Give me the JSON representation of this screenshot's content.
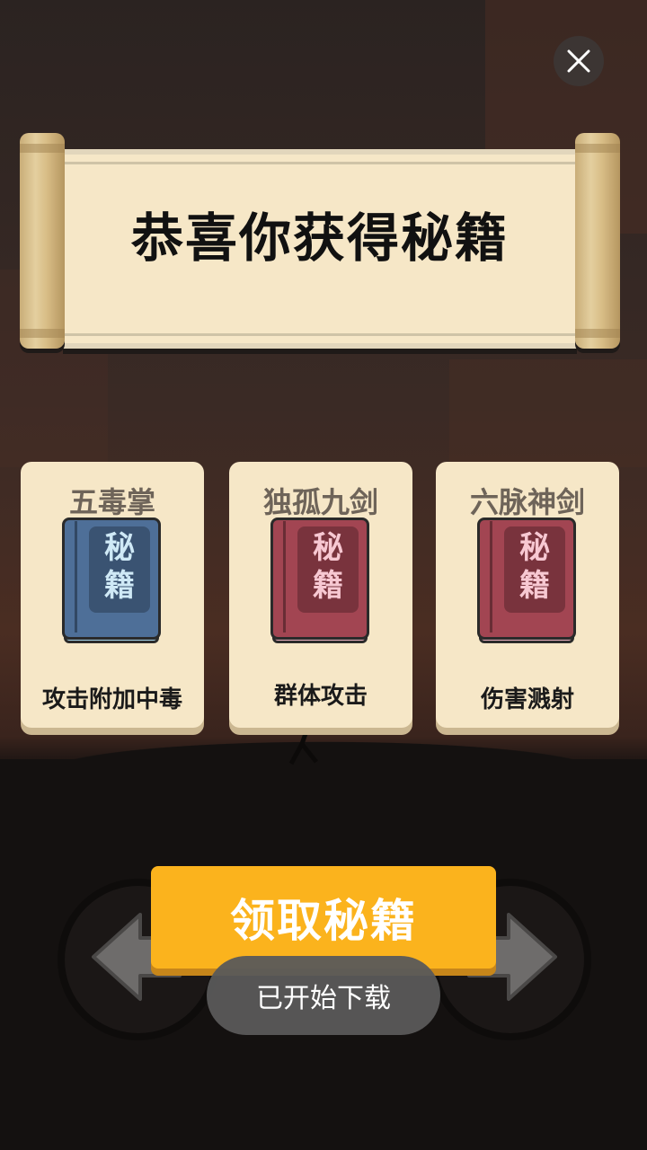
{
  "dialog": {
    "title": "恭喜你获得秘籍",
    "close_icon": "close-icon"
  },
  "cards": [
    {
      "name": "五毒掌",
      "book_chars": [
        "秘",
        "籍"
      ],
      "book_color": "#4e6f98",
      "description": "攻击附加中毒"
    },
    {
      "name": "独孤九剑",
      "book_chars": [
        "秘",
        "籍"
      ],
      "book_color": "#a24552",
      "description": "群体攻击"
    },
    {
      "name": "六脉神剑",
      "book_chars": [
        "秘",
        "籍"
      ],
      "book_color": "#a24552",
      "description": "伤害溅射"
    }
  ],
  "claim_button": {
    "label": "领取秘籍",
    "color": "#fbb31d"
  },
  "toast": {
    "text": "已开始下载"
  },
  "navigation": {
    "left_icon": "arrow-left-icon",
    "right_icon": "arrow-right-icon"
  }
}
